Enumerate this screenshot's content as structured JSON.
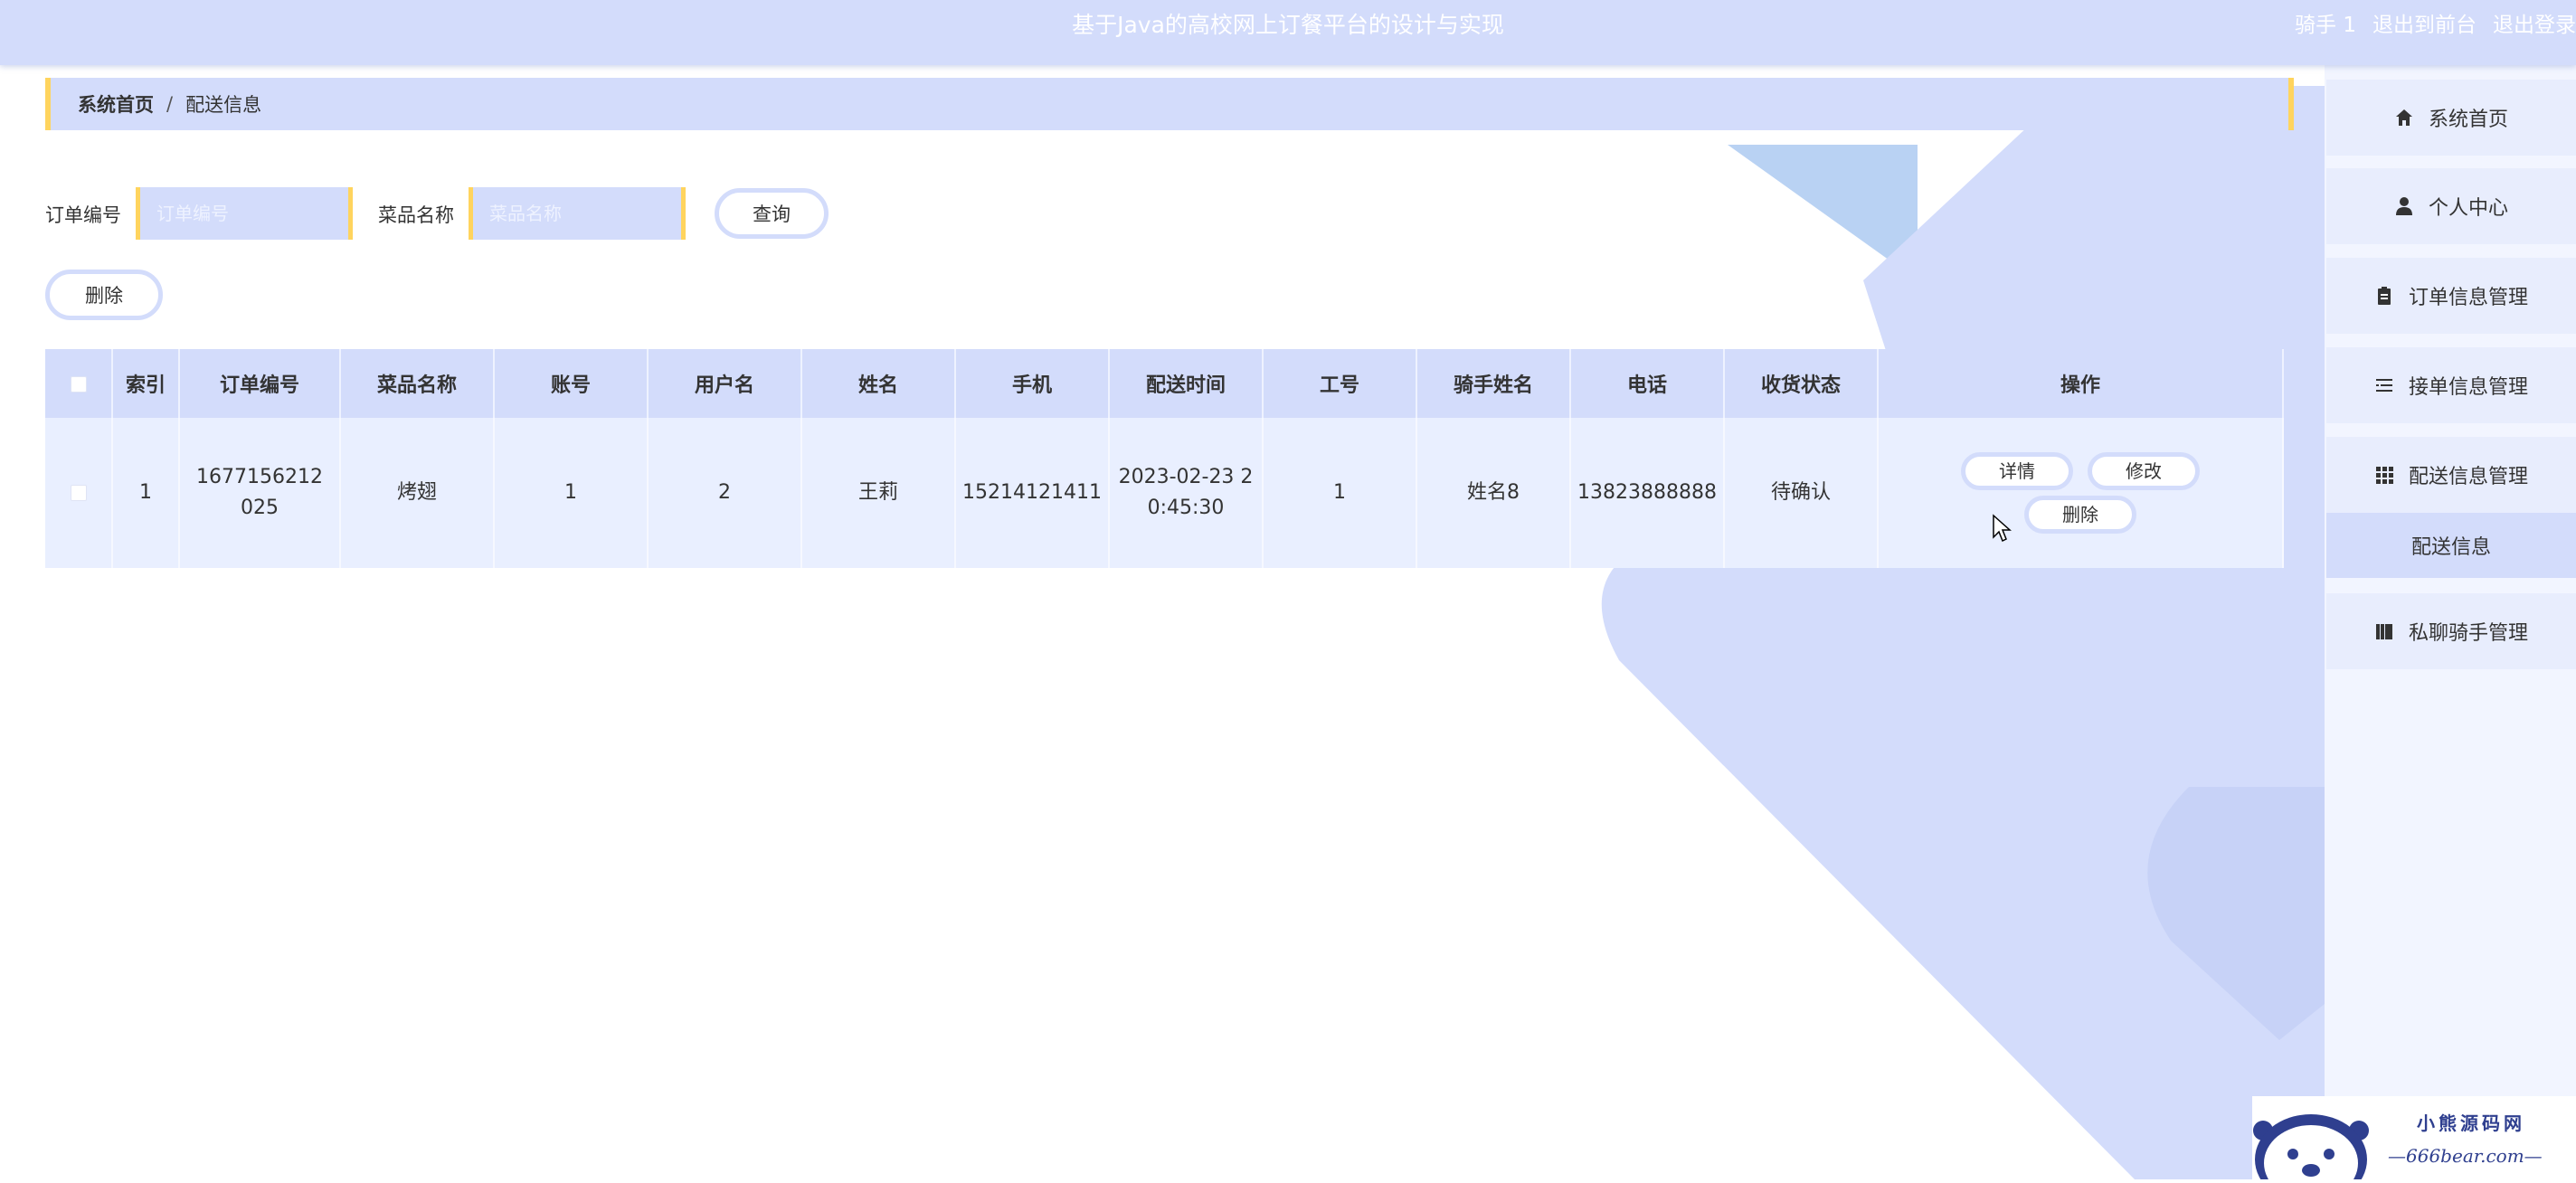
{
  "header": {
    "title": "基于Java的高校网上订餐平台的设计与实现",
    "user": "骑手 1",
    "to_front": "退出到前台",
    "logout": "退出登录"
  },
  "breadcrumb": {
    "home": "系统首页",
    "separator": "/",
    "current": "配送信息"
  },
  "search": {
    "order_label": "订单编号",
    "order_placeholder": "订单编号",
    "dish_label": "菜品名称",
    "dish_placeholder": "菜品名称",
    "query_button": "查询"
  },
  "toolbar": {
    "delete_button": "删除"
  },
  "table": {
    "columns": [
      "索引",
      "订单编号",
      "菜品名称",
      "账号",
      "用户名",
      "姓名",
      "手机",
      "配送时间",
      "工号",
      "骑手姓名",
      "电话",
      "收货状态",
      "操作"
    ],
    "rows": [
      {
        "index": "1",
        "order_no": "1677156212025",
        "dish": "烤翅",
        "account": "1",
        "username": "2",
        "name": "王莉",
        "phone": "15214121411",
        "time": "2023-02-23 20:45:30",
        "worker_id": "1",
        "rider_name": "姓名8",
        "tel": "13823888888",
        "status": "待确认",
        "actions": {
          "detail": "详情",
          "edit": "修改",
          "delete": "删除"
        }
      }
    ]
  },
  "sidebar": {
    "items": [
      {
        "label": "系统首页",
        "icon": "home-icon"
      },
      {
        "label": "个人中心",
        "icon": "user-icon"
      },
      {
        "label": "订单信息管理",
        "icon": "clipboard-icon"
      },
      {
        "label": "接单信息管理",
        "icon": "list-icon"
      },
      {
        "label": "配送信息管理",
        "icon": "grid-icon"
      },
      {
        "label": "私聊骑手管理",
        "icon": "book-icon"
      }
    ],
    "submenu": {
      "label": "配送信息"
    }
  },
  "watermark": {
    "line1": "小熊源码网",
    "line2": "—666bear.com—"
  },
  "colors": {
    "primary": "#d3dcfb",
    "accent": "#ffd45e",
    "row": "#e9efff"
  }
}
